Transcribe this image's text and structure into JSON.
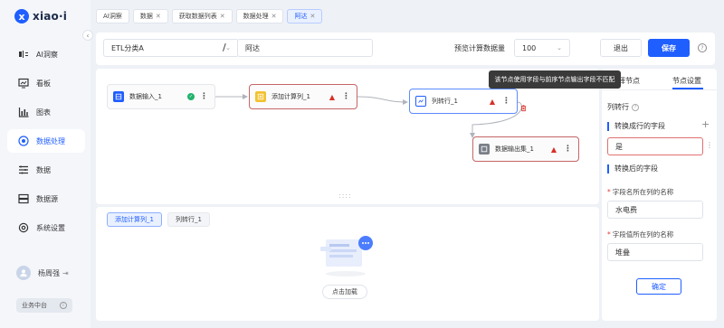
{
  "brand": {
    "name": "xiao·i",
    "mark": "x"
  },
  "sidebar": {
    "items": [
      {
        "label": "AI洞察",
        "icon": "ai-icon"
      },
      {
        "label": "看板",
        "icon": "dashboard-icon"
      },
      {
        "label": "图表",
        "icon": "chart-icon"
      },
      {
        "label": "数据处理",
        "icon": "data-process-icon",
        "active": true
      },
      {
        "label": "数据",
        "icon": "data-icon"
      },
      {
        "label": "数据源",
        "icon": "datasource-icon"
      },
      {
        "label": "系统设置",
        "icon": "settings-icon"
      }
    ],
    "user_name": "杨周强",
    "business": "业务中台"
  },
  "tabs": [
    {
      "label": "AI洞察",
      "closable": false
    },
    {
      "label": "数据",
      "closable": true
    },
    {
      "label": "获取数据列表",
      "closable": true
    },
    {
      "label": "数据处理",
      "closable": true
    },
    {
      "label": "阿达",
      "closable": true,
      "active": true
    }
  ],
  "toolbar": {
    "category": "ETL分类A",
    "separator": "/",
    "name_value": "阿达",
    "preview_label": "预览计算数据量",
    "preview_value": "100",
    "exit_label": "退出",
    "save_label": "保存",
    "help": "?"
  },
  "canvas": {
    "nodes": {
      "input": "数据输入_1",
      "calc": "添加计算列_1",
      "pivot": "列转行_1",
      "output": "数据输出集_1"
    },
    "tooltip": "该节点使用字段与前序节点输出字段不匹配",
    "resize_handle": "::::"
  },
  "preview": {
    "tabs": [
      {
        "label": "添加计算列_1",
        "active": true
      },
      {
        "label": "列转行_1",
        "active": false
      }
    ],
    "load_label": "点击加载"
  },
  "right_panel": {
    "tabs": [
      "选择节点",
      "节点设置"
    ],
    "active_tab": "节点设置",
    "title": "列转行",
    "section_source": "转换成行的字段",
    "source_value": "是",
    "section_target": "转换后的字段",
    "name_col_label": "字段名所在列的名称",
    "name_col_value": "水电费",
    "value_col_label": "字段值所在列的名称",
    "value_col_value": "堆叠",
    "ok_label": "确定"
  },
  "colors": {
    "accent": "#1f5eff",
    "error": "#d93025",
    "success": "#21b36b"
  }
}
